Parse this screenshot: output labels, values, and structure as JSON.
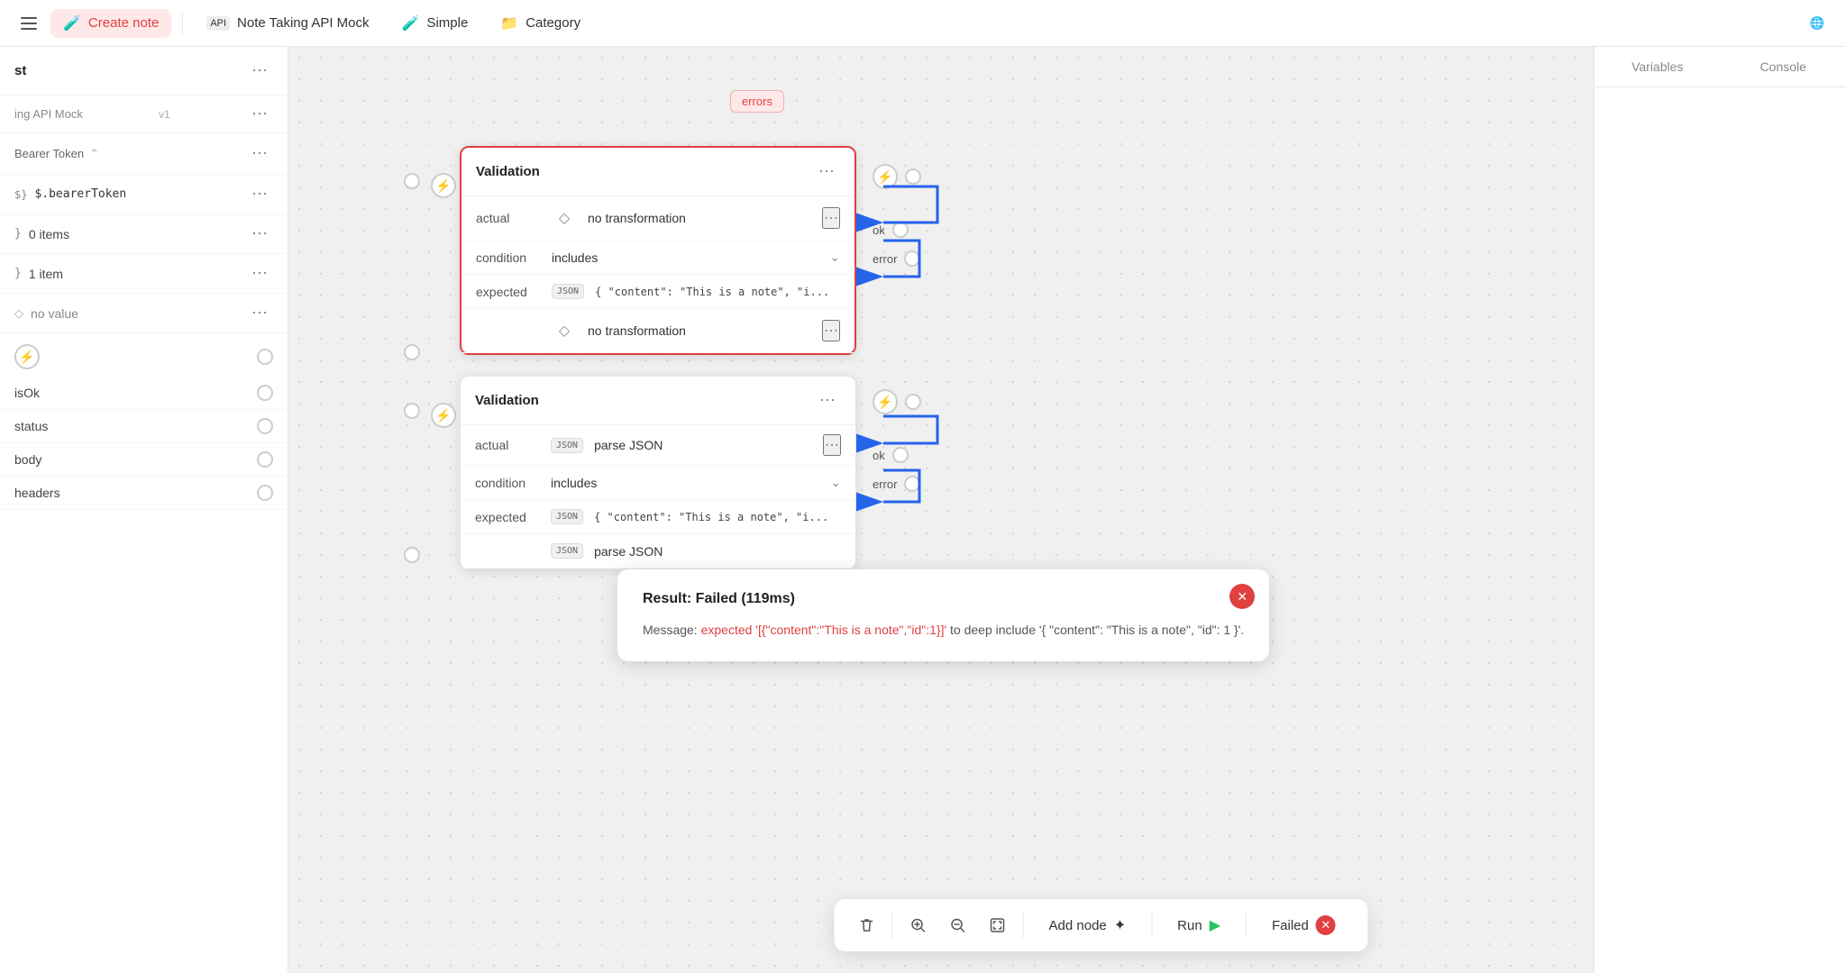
{
  "topbar": {
    "sidebar_icon": "☰",
    "tabs": [
      {
        "label": "Create note",
        "icon": "🧪",
        "active": true
      },
      {
        "label": "Note Taking API Mock",
        "icon": "API",
        "active": false
      },
      {
        "label": "Simple",
        "icon": "🧪",
        "active": false
      },
      {
        "label": "Category",
        "icon": "📁",
        "active": false
      }
    ],
    "right_icon": "🌐"
  },
  "right_panel": {
    "tabs": [
      {
        "label": "Variables",
        "active": false
      },
      {
        "label": "Console",
        "active": false
      }
    ]
  },
  "left_panel": {
    "title": "st",
    "api_name": "ing API Mock",
    "api_version": "v1",
    "auth_type": "Bearer Token",
    "auth_value": "$.bearerToken",
    "items": [
      {
        "label": "0 items",
        "type": "braces"
      },
      {
        "label": "1 item",
        "type": "braces"
      },
      {
        "label": "no value",
        "type": "diamond"
      }
    ],
    "fields": [
      {
        "label": "isOk",
        "type": "circle"
      },
      {
        "label": "status",
        "type": "circle"
      },
      {
        "label": "body",
        "type": "circle"
      },
      {
        "label": "headers",
        "type": "circle"
      }
    ]
  },
  "errors_badge": "errors",
  "validation_card_1": {
    "title": "Validation",
    "rows": [
      {
        "label": "actual",
        "icon": "◇",
        "value": "no transformation",
        "has_end": true
      },
      {
        "label": "condition",
        "value": "includes",
        "has_end": true
      },
      {
        "label": "expected",
        "icon": "JSON",
        "value": "{ \"content\": \"This is a note\", \"i...",
        "has_end": false
      },
      {
        "label": "",
        "icon": "◇",
        "value": "no transformation",
        "has_end": true
      }
    ]
  },
  "validation_card_2": {
    "title": "Validation",
    "rows": [
      {
        "label": "actual",
        "icon": "JSON",
        "value": "parse JSON",
        "has_end": true
      },
      {
        "label": "condition",
        "value": "includes",
        "has_end": true
      },
      {
        "label": "expected",
        "icon": "JSON",
        "value": "{ \"content\": \"This is a note\", \"i...",
        "has_end": false
      },
      {
        "label": "",
        "icon": "JSON",
        "value": "parse JSON",
        "has_end": false
      }
    ]
  },
  "result_panel": {
    "title": "Result: Failed (119ms)",
    "message_prefix": "Message: ",
    "message_highlight": "expected '[{\"content\":\"This is a note\",\"id\":1}]'",
    "message_suffix": " to deep include '{ \"content\": \"This is a note\", \"id\": 1 }'."
  },
  "bottom_toolbar": {
    "delete_icon": "🗑",
    "zoom_in_icon": "+",
    "zoom_out_icon": "−",
    "fit_icon": "⊞",
    "add_node_label": "Add node",
    "add_node_icon": "✦",
    "run_label": "Run",
    "run_icon": "▶",
    "failed_label": "Failed",
    "failed_x": "✕"
  }
}
